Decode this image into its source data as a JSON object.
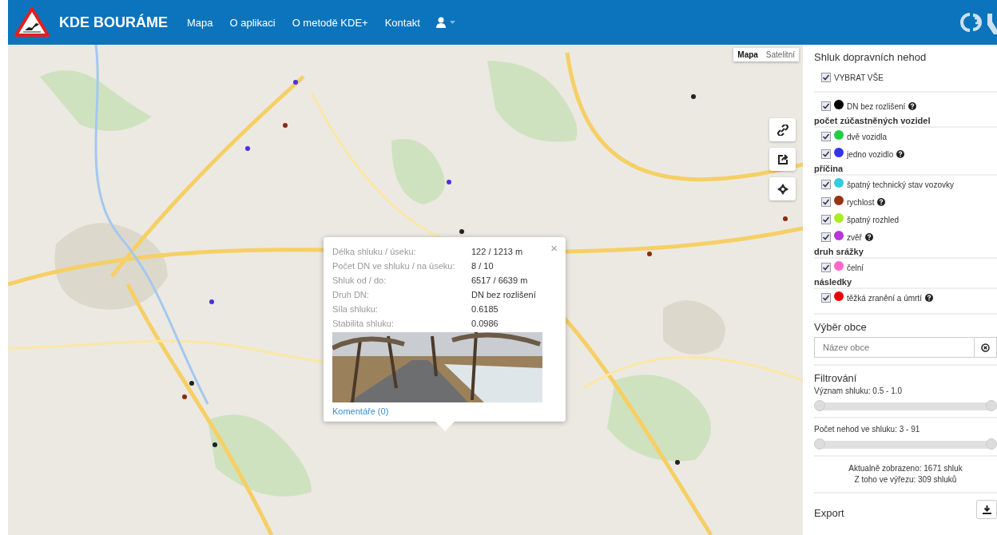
{
  "navbar": {
    "brand": "KDE BOURÁME",
    "links": [
      {
        "label": "Mapa"
      },
      {
        "label": "O aplikaci"
      },
      {
        "label": "O metodě KDE+"
      },
      {
        "label": "Kontakt"
      }
    ]
  },
  "map": {
    "map_types": [
      {
        "label": "Mapa",
        "selected": true
      },
      {
        "label": "Satelitní",
        "selected": false
      }
    ],
    "popup": {
      "rows": [
        {
          "label": "Délka shluku / úseku:",
          "value": "122 / 1213 m"
        },
        {
          "label": "Počet DN ve shluku / na úseku:",
          "value": "8 / 10"
        },
        {
          "label": "Shluk od / do:",
          "value": "6517 / 6639 m"
        },
        {
          "label": "Druh DN:",
          "value": "DN bez rozlišení"
        },
        {
          "label": "Síla shluku:",
          "value": "0.6185"
        },
        {
          "label": "Stabilita shluku:",
          "value": "0.0986"
        }
      ],
      "close": "×",
      "link": "Komentáře (0)"
    }
  },
  "sidebar": {
    "title": "Shluk dopravních nehod",
    "select_all": {
      "label": "VYBRAT VŠE",
      "checked": true
    },
    "legend": [
      {
        "items": [
          {
            "label": "DN bez rozlišení",
            "color": "#000000",
            "checked": true,
            "help": true
          }
        ]
      },
      {
        "heading": "počet zúčastněných vozidel",
        "items": [
          {
            "label": "dvě vozidla",
            "color": "#22cc44",
            "checked": true,
            "help": false
          },
          {
            "label": "jedno vozidlo",
            "color": "#3333ee",
            "checked": true,
            "help": true
          }
        ]
      },
      {
        "heading": "příčina",
        "items": [
          {
            "label": "špatný technický stav vozovky",
            "color": "#33ccdd",
            "checked": true,
            "help": false
          },
          {
            "label": "rychlost",
            "color": "#993311",
            "checked": true,
            "help": true
          },
          {
            "label": "špatný rozhled",
            "color": "#aaee22",
            "checked": true,
            "help": false
          },
          {
            "label": "zvěř",
            "color": "#bb33dd",
            "checked": true,
            "help": true
          }
        ]
      },
      {
        "heading": "druh srážky",
        "items": [
          {
            "label": "čelní",
            "color": "#ff66cc",
            "checked": true,
            "help": false
          }
        ]
      },
      {
        "heading": "následky",
        "items": [
          {
            "label": "těžká zranění a úmrtí",
            "color": "#ee0000",
            "checked": true,
            "help": true
          }
        ]
      }
    ],
    "municipality": {
      "heading": "Výběr obce",
      "placeholder": "Název obce"
    },
    "filters": {
      "heading": "Filtrování",
      "sliders": [
        {
          "label": "Význam shluku: 0.5 - 1.0",
          "level": 1
        },
        {
          "label": "Počet nehod ve shluku: 3 - 91",
          "level": 1
        }
      ]
    },
    "stats": [
      "Aktualně zobrazeno: 1671 shluk",
      "Z toho ve výřezu: 309 shluků"
    ],
    "export": {
      "heading": "Export"
    }
  }
}
